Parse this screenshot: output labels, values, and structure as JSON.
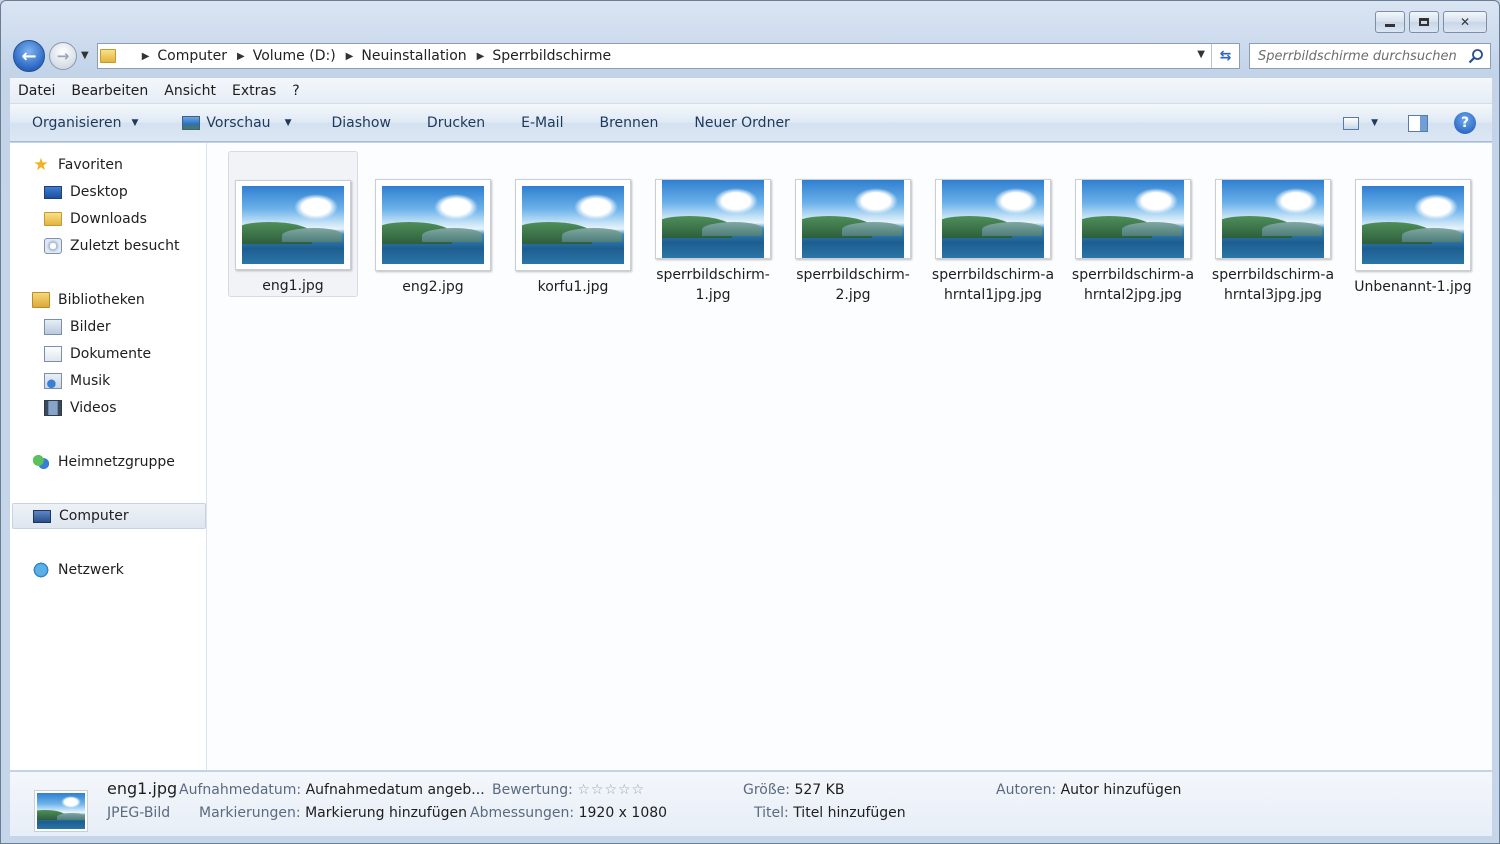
{
  "window": {
    "minimize_label": "",
    "maximize_label": "",
    "close_label": "✕"
  },
  "nav": {
    "back_glyph": "←",
    "forward_glyph": "→",
    "breadcrumb": [
      "Computer",
      "Volume (D:)",
      "Neuinstallation",
      "Sperrbildschirme"
    ],
    "search_placeholder": "Sperrbildschirme durchsuchen",
    "refresh_glyph": "⇆"
  },
  "menubar": [
    "Datei",
    "Bearbeiten",
    "Ansicht",
    "Extras",
    "?"
  ],
  "commandbar": {
    "organize": "Organisieren",
    "preview": "Vorschau",
    "slideshow": "Diashow",
    "print": "Drucken",
    "email": "E-Mail",
    "burn": "Brennen",
    "new_folder": "Neuer Ordner",
    "help": "?"
  },
  "sidebar": {
    "favorites": "Favoriten",
    "desktop": "Desktop",
    "downloads": "Downloads",
    "recent": "Zuletzt besucht",
    "libraries": "Bibliotheken",
    "pictures": "Bilder",
    "documents": "Dokumente",
    "music": "Musik",
    "videos": "Videos",
    "homegroup": "Heimnetzgruppe",
    "computer": "Computer",
    "network": "Netzwerk"
  },
  "files": [
    "eng1.jpg",
    "eng2.jpg",
    "korfu1.jpg",
    "sperrbildschirm-1.jpg",
    "sperrbildschirm-2.jpg",
    "sperrbildschirm-ahrntal1jpg.jpg",
    "sperrbildschirm-ahrntal2jpg.jpg",
    "sperrbildschirm-ahrntal3jpg.jpg",
    "Unbenannt-1.jpg"
  ],
  "details": {
    "name": "eng1.jpg",
    "type": "JPEG-Bild",
    "date_label": "Aufnahmedatum:",
    "date_value": "Aufnahmedatum angeb...",
    "tags_label": "Markierungen:",
    "tags_value": "Markierung hinzufügen",
    "rating_label": "Bewertung:",
    "rating_stars": "☆☆☆☆☆",
    "dimensions_label": "Abmessungen:",
    "dimensions_value": "1920 x 1080",
    "size_label": "Größe:",
    "size_value": "527 KB",
    "title_label": "Titel:",
    "title_value": "Titel hinzufügen",
    "authors_label": "Autoren:",
    "authors_value": "Autor hinzufügen"
  }
}
